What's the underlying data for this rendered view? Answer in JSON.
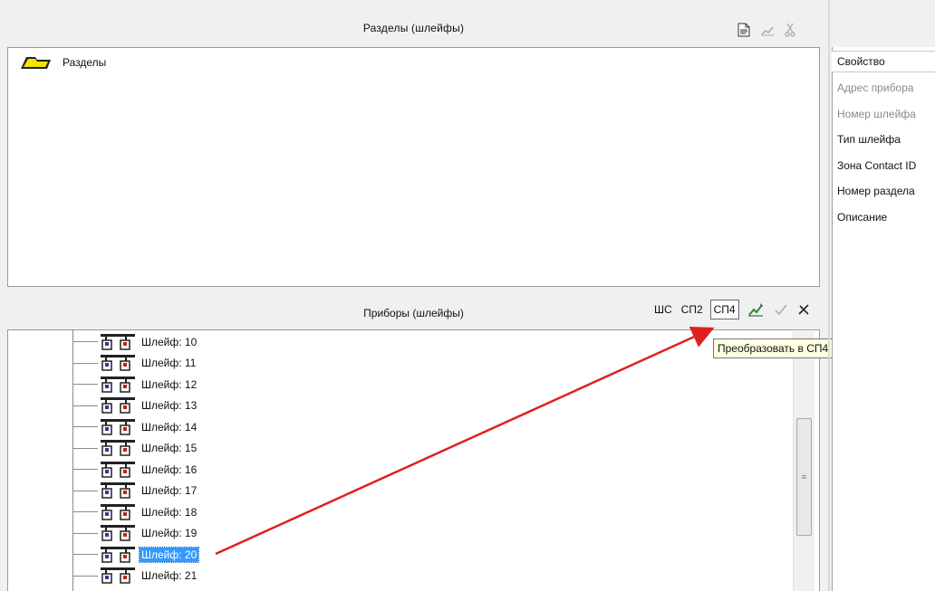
{
  "sections_panel": {
    "title": "Разделы (шлейфы)",
    "root_label": "Разделы"
  },
  "devices_panel": {
    "title": "Приборы  (шлейфы)",
    "toolbar": {
      "shs_label": "ШС",
      "sp2_label": "СП2",
      "sp4_label": "СП4"
    },
    "tooltip": "Преобразовать в СП4",
    "loops": [
      {
        "label": "Шлейф: 10",
        "selected": false
      },
      {
        "label": "Шлейф: 11",
        "selected": false
      },
      {
        "label": "Шлейф: 12",
        "selected": false
      },
      {
        "label": "Шлейф: 13",
        "selected": false
      },
      {
        "label": "Шлейф: 14",
        "selected": false
      },
      {
        "label": "Шлейф: 15",
        "selected": false
      },
      {
        "label": "Шлейф: 16",
        "selected": false
      },
      {
        "label": "Шлейф: 17",
        "selected": false
      },
      {
        "label": "Шлейф: 18",
        "selected": false
      },
      {
        "label": "Шлейф: 19",
        "selected": false
      },
      {
        "label": "Шлейф: 20",
        "selected": true
      },
      {
        "label": "Шлейф: 21",
        "selected": false
      }
    ]
  },
  "properties_panel": {
    "header": "Свойство",
    "rows": [
      {
        "label": "Адрес прибора",
        "muted": true
      },
      {
        "label": "Номер шлейфа",
        "muted": true
      },
      {
        "label": "Тип шлейфа",
        "muted": false
      },
      {
        "label": "Зона Contact ID",
        "muted": false
      },
      {
        "label": "Номер раздела",
        "muted": false
      },
      {
        "label": "Описание",
        "muted": false
      }
    ]
  },
  "colors": {
    "selection": "#3399ff",
    "arrow": "#e02020",
    "tooltip_bg": "#ffffe1"
  }
}
